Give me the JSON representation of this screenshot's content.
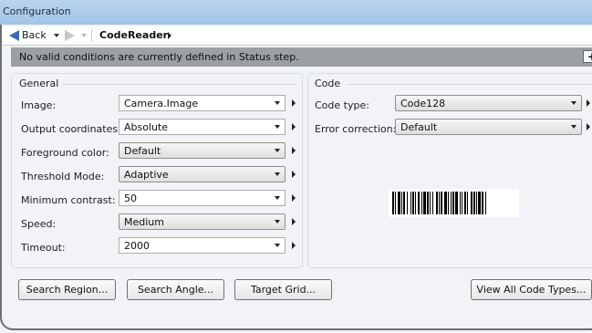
{
  "window": {
    "title": "Configuration"
  },
  "nav": {
    "back_label": "Back",
    "breadcrumb": "CodeReader"
  },
  "status": {
    "message": "No valid conditions are currently defined in Status step.",
    "add_label": "+"
  },
  "general": {
    "title": "General",
    "fields": [
      {
        "label": "Image:",
        "value": "Camera.Image"
      },
      {
        "label": "Output coordinates:",
        "value": "Absolute"
      },
      {
        "label": "Foreground color:",
        "value": "Default"
      },
      {
        "label": "Threshold Mode:",
        "value": "Adaptive"
      },
      {
        "label": "Minimum contrast:",
        "value": "50"
      },
      {
        "label": "Speed:",
        "value": "Medium"
      },
      {
        "label": "Timeout:",
        "value": "2000"
      }
    ]
  },
  "code": {
    "title": "Code",
    "fields": [
      {
        "label": "Code type:",
        "value": "Code128"
      },
      {
        "label": "Error correction:",
        "value": "Default"
      }
    ]
  },
  "buttons": {
    "search_region": "Search Region...",
    "search_angle": "Search Angle...",
    "target_grid": "Target Grid...",
    "view_all_code_types": "View All Code Types..."
  },
  "colors": {
    "title_bar": "#a9c8e8",
    "status_bar": "#9c9fa4",
    "back_arrow": "#3a67b4"
  }
}
